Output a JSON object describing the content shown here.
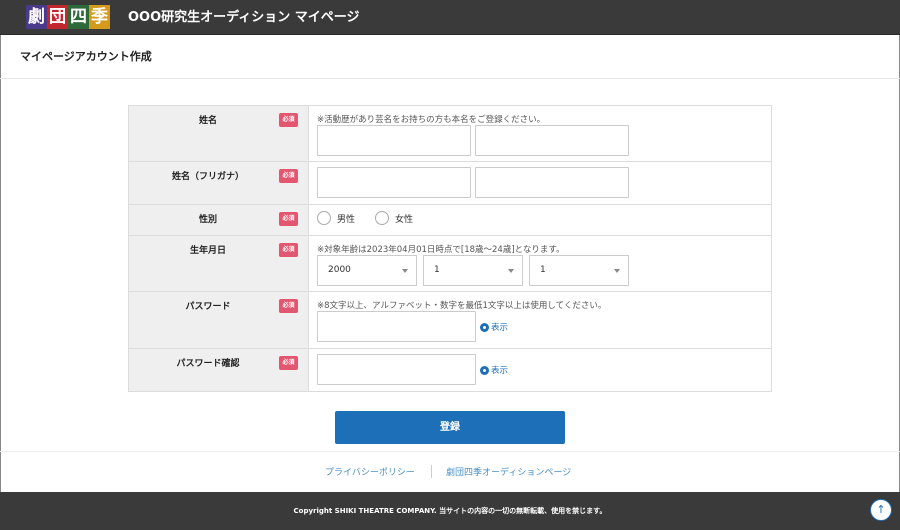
{
  "header": {
    "logo_chars": [
      "劇",
      "団",
      "四",
      "季"
    ],
    "site_title": "OOO研究生オーディション マイページ"
  },
  "page": {
    "title": "マイページアカウント作成"
  },
  "required_label": "必須",
  "form": {
    "name": {
      "label": "姓名",
      "note": "※活動歴があり芸名をお持ちの方も本名をご登録ください。"
    },
    "kana": {
      "label": "姓名（フリガナ）"
    },
    "gender": {
      "label": "性別",
      "options": [
        "男性",
        "女性"
      ]
    },
    "birthday": {
      "label": "生年月日",
      "note": "※対象年齢は2023年04月01日時点で[18歳～24歳]となります。",
      "year": "2000",
      "month": "1",
      "day": "1"
    },
    "password": {
      "label": "パスワード",
      "note": "※8文字以上、アルファベット・数字を最低1文字以上は使用してください。",
      "show_label": "表示"
    },
    "password_confirm": {
      "label": "パスワード確認",
      "show_label": "表示"
    }
  },
  "submit_label": "登録",
  "footer": {
    "links": [
      "プライバシーポリシー",
      "劇団四季オーディションページ"
    ],
    "copyright": "Copyright SHIKI THEATRE COMPANY. 当サイトの内容の一切の無断転載、使用を禁じます。"
  },
  "colors": {
    "accent": "#1d6fb8",
    "required": "#e2566f",
    "header_bg": "#3a3a3a"
  },
  "icons": {
    "eye": "eye-icon",
    "back_to_top": "arrow-up-icon"
  }
}
